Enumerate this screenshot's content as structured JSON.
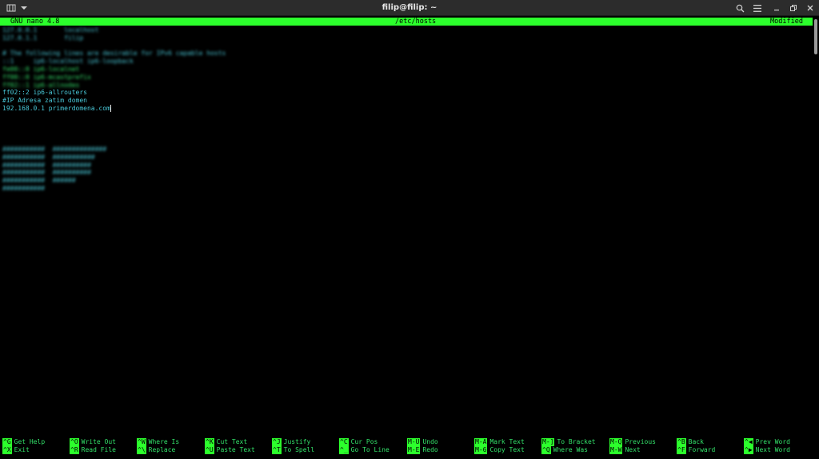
{
  "window": {
    "title": "filip@filip: ~",
    "left_buttons": [
      "new-tab-icon",
      "chevron-down-icon"
    ],
    "right_buttons": [
      "search-icon",
      "menu-icon",
      "minimize-icon",
      "restore-icon",
      "close-icon"
    ]
  },
  "nano": {
    "version": "GNU nano 4.8",
    "filename": "/etc/hosts",
    "status": "Modified"
  },
  "editor": {
    "lines": [
      {
        "text": "127.0.0.1       localhost",
        "style": "blur teal"
      },
      {
        "text": "127.0.1.1       filip",
        "style": "blur teal"
      },
      {
        "text": "",
        "style": ""
      },
      {
        "text": "# The following lines are desirable for IPv6 capable hosts",
        "style": "blur teal"
      },
      {
        "text": "::1     ip6-localhost ip6-loopback",
        "style": "blur teal"
      },
      {
        "text": "fe00::0 ip6-localnet",
        "style": "blur green"
      },
      {
        "text": "ff00::0 ip6-mcastprefix",
        "style": "blur green"
      },
      {
        "text": "ff02::1 ip6-allnodes",
        "style": "blur green"
      },
      {
        "text": "ff02::2 ip6-allrouters",
        "style": "teal"
      },
      {
        "text": "#IP Adresa zatim domen",
        "style": "teal"
      },
      {
        "text": "192.168.0.1 primerdomena.com",
        "style": "teal"
      }
    ],
    "blurred_block": [
      "###########  ##############",
      "###########  ###########",
      "###########  ##########",
      "###########  ##########",
      "###########  ######",
      "###########"
    ]
  },
  "shortcuts": {
    "top": [
      {
        "key": "^G",
        "label": "Get Help"
      },
      {
        "key": "^O",
        "label": "Write Out"
      },
      {
        "key": "^W",
        "label": "Where Is"
      },
      {
        "key": "^K",
        "label": "Cut Text"
      },
      {
        "key": "^J",
        "label": "Justify"
      },
      {
        "key": "^C",
        "label": "Cur Pos"
      },
      {
        "key": "M-U",
        "label": "Undo"
      },
      {
        "key": "M-A",
        "label": "Mark Text"
      },
      {
        "key": "M-]",
        "label": "To Bracket"
      },
      {
        "key": "M-Q",
        "label": "Previous"
      },
      {
        "key": "^B",
        "label": "Back"
      },
      {
        "key": "^◀",
        "label": "Prev Word"
      }
    ],
    "bottom": [
      {
        "key": "^X",
        "label": "Exit"
      },
      {
        "key": "^R",
        "label": "Read File"
      },
      {
        "key": "^\\",
        "label": "Replace"
      },
      {
        "key": "^U",
        "label": "Paste Text"
      },
      {
        "key": "^T",
        "label": "To Spell"
      },
      {
        "key": "^_",
        "label": "Go To Line"
      },
      {
        "key": "M-E",
        "label": "Redo"
      },
      {
        "key": "M-6",
        "label": "Copy Text"
      },
      {
        "key": "^Q",
        "label": "Where Was"
      },
      {
        "key": "M-W",
        "label": "Next"
      },
      {
        "key": "^F",
        "label": "Forward"
      },
      {
        "key": "^▶",
        "label": "Next Word"
      }
    ]
  },
  "colors": {
    "accent_green": "#2cff2c",
    "text_green": "#33e26a",
    "text_teal": "#49c9d9",
    "titlebar": "#2c2c2c"
  }
}
